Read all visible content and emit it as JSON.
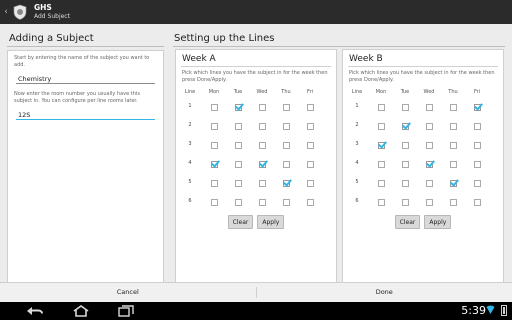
{
  "actionbar": {
    "title": "GHS",
    "subtitle": "Add Subject"
  },
  "left": {
    "heading": "Adding a Subject",
    "name_hint": "Start by entering the name of the subject you want to add.",
    "name_value": "Chemistry",
    "room_hint": "Now enter the room number you usually have this subject in. You can configure per line rooms later.",
    "room_value": "12S"
  },
  "right": {
    "heading": "Setting up the Lines",
    "instructions": "Pick which lines you have the subject in for the week then press Done/Apply.",
    "columns": [
      "Line",
      "Mon",
      "Tue",
      "Wed",
      "Thu",
      "Fri"
    ],
    "lines": [
      "1",
      "2",
      "3",
      "4",
      "5",
      "6"
    ],
    "clear_label": "Clear",
    "apply_label": "Apply",
    "weeks": [
      {
        "title": "Week A",
        "checked": [
          [
            false,
            true,
            false,
            false,
            false
          ],
          [
            false,
            false,
            false,
            false,
            false
          ],
          [
            false,
            false,
            false,
            false,
            false
          ],
          [
            true,
            false,
            true,
            false,
            false
          ],
          [
            false,
            false,
            false,
            true,
            false
          ],
          [
            false,
            false,
            false,
            false,
            false
          ]
        ]
      },
      {
        "title": "Week B",
        "checked": [
          [
            false,
            false,
            false,
            false,
            true
          ],
          [
            false,
            true,
            false,
            false,
            false
          ],
          [
            true,
            false,
            false,
            false,
            false
          ],
          [
            false,
            false,
            true,
            false,
            false
          ],
          [
            false,
            false,
            false,
            true,
            false
          ],
          [
            false,
            false,
            false,
            false,
            false
          ]
        ]
      }
    ]
  },
  "bottom": {
    "cancel": "Cancel",
    "done": "Done"
  },
  "statusbar": {
    "time": "5:39"
  },
  "colors": {
    "accent": "#33b5e5",
    "actionbar": "#2b2b2b"
  }
}
